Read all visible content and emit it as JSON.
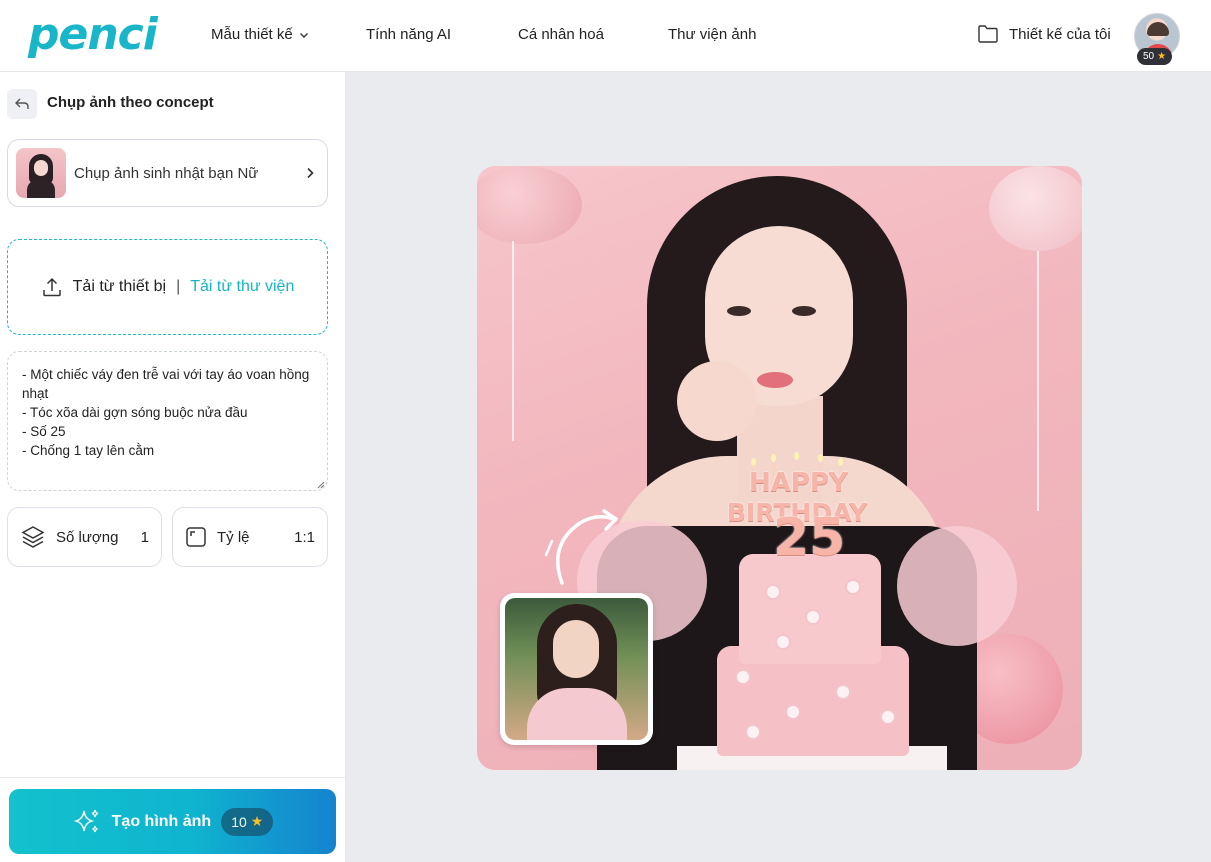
{
  "header": {
    "logo": "penci",
    "nav": [
      {
        "label": "Mẫu thiết kế",
        "has_dropdown": true
      },
      {
        "label": "Tính năng AI"
      },
      {
        "label": "Cá nhân hoá"
      },
      {
        "label": "Thư viện ảnh"
      }
    ],
    "my_designs": "Thiết kế của tôi",
    "credits": "50"
  },
  "sidebar": {
    "title": "Chụp ảnh theo concept",
    "concept": "Chụp ảnh sinh nhật bạn Nữ",
    "upload_device": "Tải từ thiết bị",
    "upload_separator": "|",
    "upload_library": "Tải từ thư viện",
    "prompt": "- Một chiếc váy đen trễ vai với tay áo voan hồng nhạt\n- Tóc xõa dài gợn sóng buộc nửa đầu\n- Số 25\n- Chống 1 tay lên cằm",
    "quantity_label": "Số lượng",
    "quantity_value": "1",
    "ratio_label": "Tỷ lệ",
    "ratio_value": "1:1",
    "generate_label": "Tạo hình ảnh",
    "generate_cost": "10"
  },
  "preview": {
    "cake_text_1": "HAPPY",
    "cake_text_2": "BIRTHDAY",
    "cake_number": "25"
  },
  "colors": {
    "brand": "#19b6c9",
    "accent_link": "#15b5c5",
    "button_gradient_start": "#13c2cd",
    "button_gradient_end": "#1583cf",
    "star": "#fbbf24"
  },
  "icons": {
    "nav_dropdown": "chevron-down-icon",
    "folder": "folder-icon",
    "back": "back-arrow-icon",
    "concept_next": "chevron-right-icon",
    "upload": "upload-icon",
    "layers": "layers-icon",
    "ratio": "aspect-ratio-icon",
    "sparkle": "sparkle-icon",
    "star": "star-icon"
  }
}
